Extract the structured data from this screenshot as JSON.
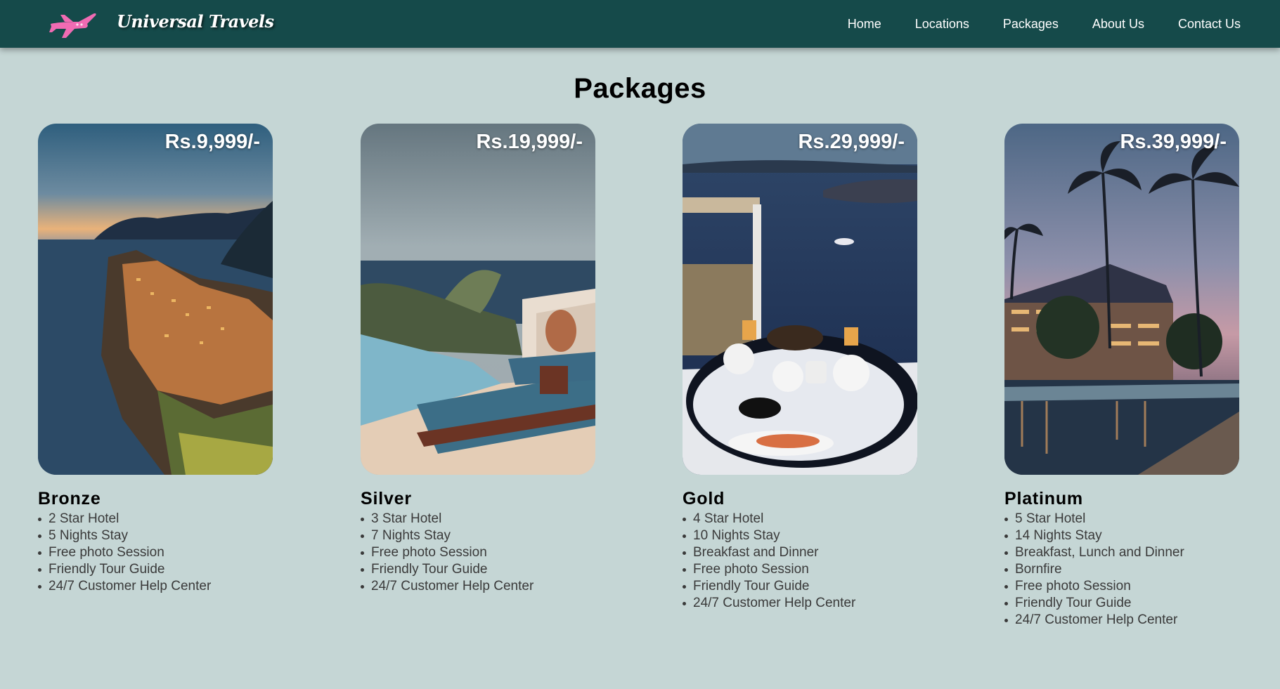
{
  "brand": {
    "name": "Universal Travels",
    "logo_icon": "airplane-icon",
    "logo_color": "#f472b6"
  },
  "nav": {
    "items": [
      {
        "label": "Home"
      },
      {
        "label": "Locations"
      },
      {
        "label": "Packages"
      },
      {
        "label": "About Us"
      },
      {
        "label": "Contact Us"
      }
    ]
  },
  "page_title": "Packages",
  "colors": {
    "navbar": "#154a4a",
    "background": "#c5d6d5",
    "title": "#000000"
  },
  "packages": [
    {
      "tier": "Bronze",
      "price": "Rs.9,999/-",
      "image": "coastal-village-sunset",
      "features": [
        "2 Star Hotel",
        "5 Nights Stay",
        "Free photo Session",
        "Friendly Tour Guide",
        "24/7 Customer Help Center"
      ]
    },
    {
      "tier": "Silver",
      "price": "Rs.19,999/-",
      "image": "infinity-pool-loungers",
      "features": [
        "3 Star Hotel",
        "7 Nights Stay",
        "Free photo Session",
        "Friendly Tour Guide",
        "24/7 Customer Help Center"
      ]
    },
    {
      "tier": "Gold",
      "price": "Rs.29,999/-",
      "image": "sea-view-breakfast-table",
      "features": [
        "4 Star Hotel",
        "10 Nights Stay",
        "Breakfast and Dinner",
        "Free photo Session",
        "Friendly Tour Guide",
        "24/7 Customer Help Center"
      ]
    },
    {
      "tier": "Platinum",
      "price": "Rs.39,999/-",
      "image": "palm-resort-pool-dusk",
      "features": [
        "5 Star Hotel",
        "14 Nights Stay",
        "Breakfast, Lunch and Dinner",
        "Bornfire",
        "Free photo Session",
        "Friendly Tour Guide",
        "24/7 Customer Help Center"
      ]
    }
  ]
}
